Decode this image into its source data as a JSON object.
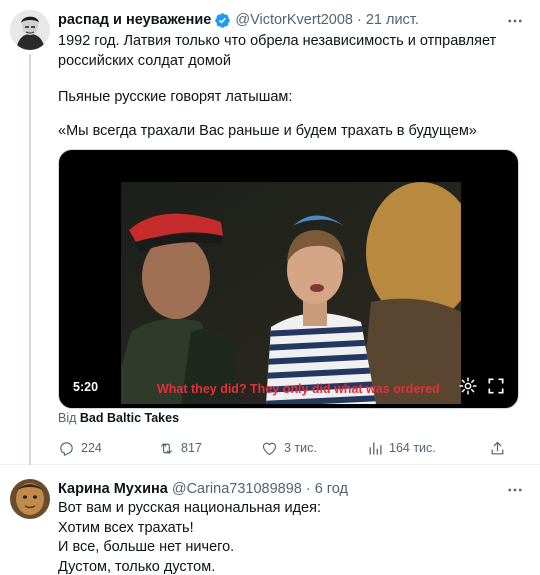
{
  "tweet": {
    "author_name": "распад и неуважение",
    "author_handle": "@VictorKvert2008",
    "separator": "·",
    "time": "21 лист.",
    "text_1": "1992 год. Латвия только что обрела независимость и отправляет российских солдат домой",
    "text_2": "Пьяные русские говорят латышам:",
    "text_3": "«Мы всегда трахали Вас раньше и будем трахать в будущем»",
    "video": {
      "timecode": "5:20",
      "subtitle": "What they did? They only did what was ordered"
    },
    "source_prefix": "Від",
    "source_name": "Bad Baltic Takes",
    "actions": {
      "replies": "224",
      "retweets": "817",
      "likes": "3 тис.",
      "views": "164 тис."
    },
    "icons": [
      "verified-icon",
      "more-icon",
      "settings-icon",
      "fullscreen-icon",
      "reply-icon",
      "retweet-icon",
      "like-icon",
      "views-icon",
      "share-icon"
    ]
  },
  "reply": {
    "author_name": "Карина Мухина",
    "author_handle": "@Carina731089898",
    "separator": "·",
    "time": "6 год",
    "lines": [
      "Вот вам и русская национальная идея:",
      "Хотим всех трахать!",
      "И все, больше нет ничего.",
      "Дустом, только дустом."
    ]
  },
  "colors": {
    "text": "#0f1419",
    "secondary": "#536471",
    "verified": "#1d9bf0",
    "subtitle": "#e0323b"
  }
}
